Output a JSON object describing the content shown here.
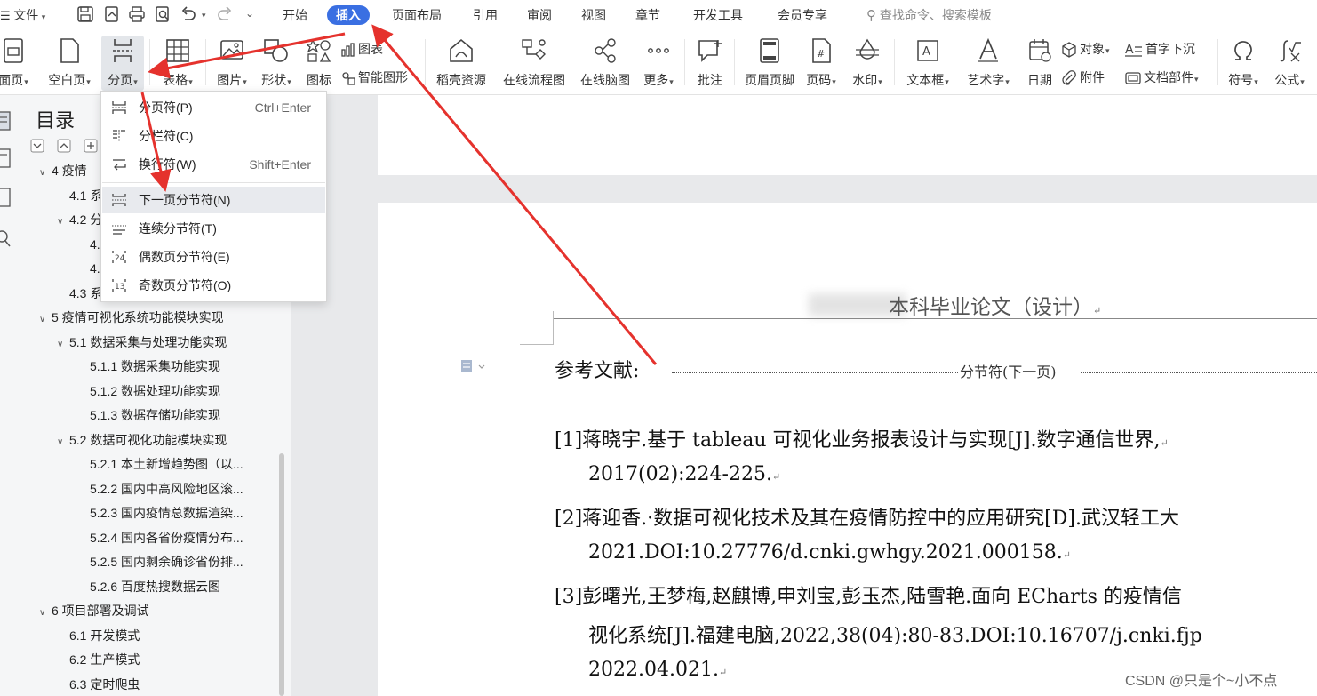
{
  "menubar": {
    "file_label": "文件",
    "tabs": [
      {
        "label": "开始",
        "active": false
      },
      {
        "label": "插入",
        "active": true
      },
      {
        "label": "页面布局",
        "active": false
      },
      {
        "label": "引用",
        "active": false
      },
      {
        "label": "审阅",
        "active": false
      },
      {
        "label": "视图",
        "active": false
      },
      {
        "label": "章节",
        "active": false
      },
      {
        "label": "开发工具",
        "active": false
      },
      {
        "label": "会员专享",
        "active": false
      }
    ],
    "search_placeholder": "查找命令、搜索模板",
    "accent_color": "#3a6fe2"
  },
  "ribbon": {
    "cover_page": "面页",
    "blank_page": "空白页",
    "page_break": "分页",
    "table": "表格",
    "picture": "图片",
    "shape": "形状",
    "icons": "图标",
    "chart": "图表",
    "smart_art": "智能图形",
    "straw_resources": "稻壳资源",
    "online_flowchart": "在线流程图",
    "online_mindmap": "在线脑图",
    "more": "更多",
    "comment": "批注",
    "header_footer": "页眉页脚",
    "page_number": "页码",
    "watermark": "水印",
    "text_box": "文本框",
    "word_art": "艺术字",
    "date": "日期",
    "object": "对象",
    "attachment": "附件",
    "drop_cap": "首字下沉",
    "doc_parts": "文档部件",
    "symbol": "符号",
    "formula": "公式"
  },
  "dropdown": {
    "items": [
      {
        "label": "分页符(P)",
        "shortcut": "Ctrl+Enter",
        "highlighted": false
      },
      {
        "label": "分栏符(C)",
        "shortcut": "",
        "highlighted": false
      },
      {
        "label": "换行符(W)",
        "shortcut": "Shift+Enter",
        "highlighted": false
      },
      {
        "label": "下一页分节符(N)",
        "shortcut": "",
        "highlighted": true
      },
      {
        "label": "连续分节符(T)",
        "shortcut": "",
        "highlighted": false
      },
      {
        "label": "偶数页分节符(E)",
        "shortcut": "",
        "highlighted": false
      },
      {
        "label": "奇数页分节符(O)",
        "shortcut": "",
        "highlighted": false
      }
    ]
  },
  "toc": {
    "title": "目录",
    "items": [
      {
        "text": "4 疫情",
        "level": 1,
        "expanded": true
      },
      {
        "text": "4.1 系",
        "level": 2,
        "expanded": null
      },
      {
        "text": "4.2 分",
        "level": 2,
        "expanded": true
      },
      {
        "text": "4.",
        "level": 3,
        "expanded": null
      },
      {
        "text": "4.",
        "level": 3,
        "expanded": null
      },
      {
        "text": "4.3 系",
        "level": 2,
        "expanded": null
      },
      {
        "text": "5 疫情可视化系统功能模块实现",
        "level": 1,
        "expanded": true
      },
      {
        "text": "5.1  数据采集与处理功能实现",
        "level": 2,
        "expanded": true
      },
      {
        "text": "5.1.1  数据采集功能实现",
        "level": 3,
        "expanded": null
      },
      {
        "text": "5.1.2  数据处理功能实现",
        "level": 3,
        "expanded": null
      },
      {
        "text": "5.1.3  数据存储功能实现",
        "level": 3,
        "expanded": null
      },
      {
        "text": "5.2  数据可视化功能模块实现",
        "level": 2,
        "expanded": true
      },
      {
        "text": "5.2.1  本土新增趋势图（以...",
        "level": 3,
        "expanded": null
      },
      {
        "text": "5.2.2  国内中高风险地区滚...",
        "level": 3,
        "expanded": null
      },
      {
        "text": "5.2.3  国内疫情总数据渲染...",
        "level": 3,
        "expanded": null
      },
      {
        "text": "5.2.4  国内各省份疫情分布...",
        "level": 3,
        "expanded": null
      },
      {
        "text": "5.2.5  国内剩余确诊省份排...",
        "level": 3,
        "expanded": null
      },
      {
        "text": "5.2.6  百度热搜数据云图",
        "level": 3,
        "expanded": null
      },
      {
        "text": "6  项目部署及调试",
        "level": 1,
        "expanded": true
      },
      {
        "text": "6.1  开发模式",
        "level": 2,
        "expanded": null
      },
      {
        "text": "6.2  生产模式",
        "level": 2,
        "expanded": null
      },
      {
        "text": "6.3  定时爬虫",
        "level": 2,
        "expanded": null
      }
    ]
  },
  "document": {
    "header_text": "本科毕业论文（设计）",
    "references_heading": "参考文献:",
    "section_break_label": "分节符(下一页)",
    "references": [
      "[1]蒋晓宇.基于 tableau 可视化业务报表设计与实现[J].数字通信世界,",
      "2017(02):224-225.",
      "[2]蒋迎香.·数据可视化技术及其在疫情防控中的应用研究[D].武汉轻工大",
      "2021.DOI:10.27776/d.cnki.gwhgy.2021.000158.",
      "[3]彭曙光,王梦梅,赵麒博,申刘宝,彭玉杰,陆雪艳.面向 ECharts 的疫情信",
      "视化系统[J].福建电脑,2022,38(04):80-83.DOI:10.16707/j.cnki.fjp",
      "2022.04.021."
    ]
  },
  "watermark": "CSDN @只是个~小不点",
  "annotation_color": "#e5322d"
}
